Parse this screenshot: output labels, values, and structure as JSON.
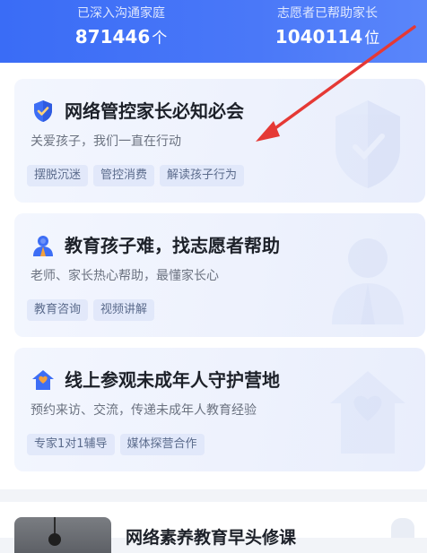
{
  "stats": {
    "families": {
      "label": "已深入沟通家庭",
      "value": "871446",
      "unit": "个"
    },
    "helped": {
      "label": "志愿者已帮助家长",
      "value": "1040114",
      "unit": "位"
    }
  },
  "cards": [
    {
      "title": "网络管控家长必知必会",
      "desc": "关爱孩子，我们一直在行动",
      "icon": "shield-check-icon",
      "tags": [
        "摆脱沉迷",
        "管控消费",
        "解读孩子行为"
      ]
    },
    {
      "title": "教育孩子难，找志愿者帮助",
      "desc": "老师、家长热心帮助，最懂家长心",
      "icon": "volunteer-person-icon",
      "tags": [
        "教育咨询",
        "视频讲解"
      ]
    },
    {
      "title": "线上参观未成年人守护营地",
      "desc": "预约来访、交流，传递未成年人教育经验",
      "icon": "house-heart-icon",
      "tags": [
        "专家1对1辅导",
        "媒体探营合作"
      ]
    }
  ],
  "article": {
    "title": "网络素养教育早头修课"
  },
  "colors": {
    "header": "#3a6cf6",
    "arrow": "#e53935",
    "icon_blue": "#3d6ef5",
    "icon_orange": "#f5a13d"
  }
}
